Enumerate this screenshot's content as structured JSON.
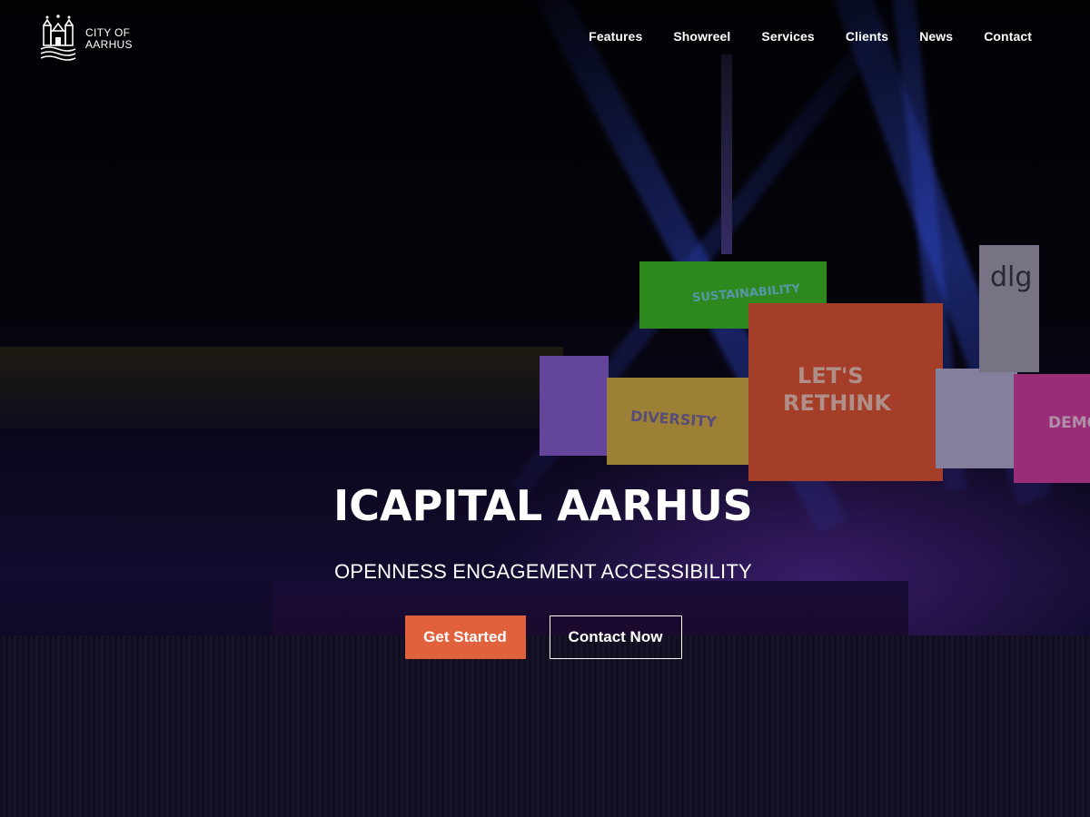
{
  "header": {
    "logo_line1": "CITY OF",
    "logo_line2": "AARHUS",
    "nav": [
      {
        "label": "Features"
      },
      {
        "label": "Showreel"
      },
      {
        "label": "Services"
      },
      {
        "label": "Clients"
      },
      {
        "label": "News"
      },
      {
        "label": "Contact"
      }
    ]
  },
  "hero": {
    "title": "ICAPITAL AARHUS",
    "subtitle": "OPENNESS ENGAGEMENT ACCESSIBILITY",
    "primary_button": "Get Started",
    "secondary_button": "Contact Now",
    "background_projections": {
      "green": "SUSTAINABILITY",
      "orange_line1": "LET'S",
      "orange_line2": "RETHINK",
      "yellow": "DIVERSITY",
      "pink": "DEMO",
      "grey": "dlg"
    }
  },
  "colors": {
    "accent": "#e2613d",
    "text": "#ffffff"
  },
  "icons": {
    "logo": "city-of-aarhus-crest-icon"
  }
}
